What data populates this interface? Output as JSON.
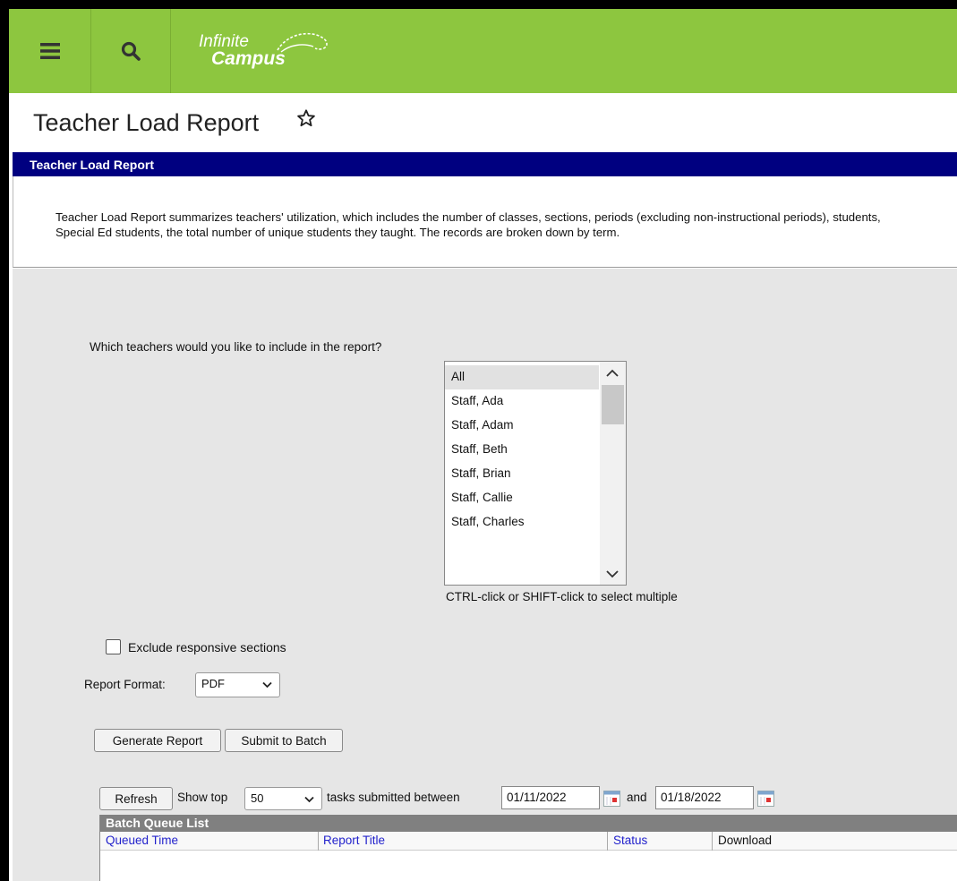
{
  "header": {
    "logo_line1": "Infinite",
    "logo_line2": "Campus",
    "menu_icon": "hamburger-menu-icon",
    "search_icon": "search-icon"
  },
  "page": {
    "title": "Teacher Load Report",
    "favorite_icon": "star-outline-icon"
  },
  "section": {
    "title": "Teacher Load Report",
    "description": "Teacher Load Report summarizes teachers' utilization, which includes the number of classes, sections, periods (excluding non-instructional periods), students, Special Ed students, the total number of unique students they taught. The records are broken down by term."
  },
  "form": {
    "teacher_question": "Which teachers would you like to include in the report?",
    "teachers": [
      "All",
      "Staff, Ada",
      "Staff, Adam",
      "Staff, Beth",
      "Staff, Brian",
      "Staff, Callie",
      "Staff, Charles"
    ],
    "selected_teacher": "All",
    "multi_select_hint": "CTRL-click or SHIFT-click to select multiple",
    "exclude_label": "Exclude responsive sections",
    "exclude_checked": false,
    "format_label": "Report Format:",
    "format_value": "PDF",
    "generate_label": "Generate Report",
    "submit_label": "Submit to Batch"
  },
  "batch": {
    "refresh_label": "Refresh",
    "show_top_label": "Show top",
    "show_top_value": "50",
    "between_label": "tasks submitted between",
    "start_date": "01/11/2022",
    "and_label": "and",
    "end_date": "01/18/2022",
    "list_title": "Batch Queue List",
    "columns": [
      "Queued Time",
      "Report Title",
      "Status",
      "Download"
    ]
  },
  "colors": {
    "header_green": "#8dc63f",
    "section_navy": "#000080",
    "link_blue": "#2222cc"
  }
}
